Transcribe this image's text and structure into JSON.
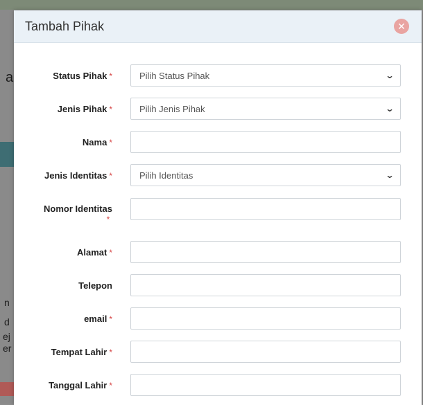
{
  "modal": {
    "title": "Tambah Pihak",
    "close_icon": "close-icon"
  },
  "form": {
    "required_mark": "*",
    "fields": [
      {
        "label": "Status Pihak",
        "type": "select",
        "value": "Pilih Status Pihak",
        "required": true
      },
      {
        "label": "Jenis Pihak",
        "type": "select",
        "value": "Pilih Jenis Pihak",
        "required": true
      },
      {
        "label": "Nama",
        "type": "text",
        "value": "",
        "required": true
      },
      {
        "label": "Jenis Identitas",
        "type": "select",
        "value": "Pilih Identitas",
        "required": true
      },
      {
        "label": "Nomor Identitas",
        "type": "text",
        "value": "",
        "required": true
      },
      {
        "label": "Alamat",
        "type": "text",
        "value": "",
        "required": true
      },
      {
        "label": "Telepon",
        "type": "text",
        "value": "",
        "required": false
      },
      {
        "label": "email",
        "type": "text",
        "value": "",
        "required": true
      },
      {
        "label": "Tempat Lahir",
        "type": "text",
        "value": "",
        "required": true
      },
      {
        "label": "Tanggal Lahir",
        "type": "text",
        "value": "",
        "required": true
      }
    ]
  },
  "background": {
    "letters": [
      "a",
      "n",
      "d",
      "ej",
      "er"
    ]
  },
  "colors": {
    "header_bg": "#eaf1f7",
    "required": "#d64545",
    "close_button": "#e9a4a1"
  }
}
